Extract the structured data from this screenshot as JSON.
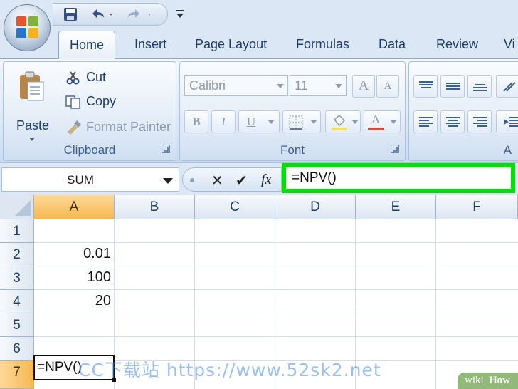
{
  "quick_access": {
    "save_icon": "save-icon",
    "undo_icon": "undo-icon",
    "redo_icon": "redo-icon",
    "customize_icon": "customize-qat-icon"
  },
  "tabs": [
    "Home",
    "Insert",
    "Page Layout",
    "Formulas",
    "Data",
    "Review",
    "Vi"
  ],
  "ribbon": {
    "clipboard": {
      "label": "Clipboard",
      "paste": "Paste",
      "cut": "Cut",
      "copy": "Copy",
      "format_painter": "Format Painter"
    },
    "font": {
      "label": "Font",
      "font_name": "Calibri",
      "font_size": "11",
      "grow_glyph": "A",
      "shrink_glyph": "A",
      "bold_glyph": "B",
      "italic_glyph": "I",
      "underline_glyph": "U",
      "font_color_glyph": "A"
    },
    "alignment": {
      "label": "A"
    }
  },
  "formula_bar": {
    "name_box": "SUM",
    "cancel_glyph": "✕",
    "enter_glyph": "✔",
    "fx_label": "fx",
    "formula": "=NPV()"
  },
  "grid": {
    "columns": [
      "A",
      "B",
      "C",
      "D",
      "E",
      "F"
    ],
    "rows": [
      "1",
      "2",
      "3",
      "4",
      "5",
      "6",
      "7"
    ],
    "selected_column": "A",
    "selected_row": "7",
    "cells": {
      "A2": "0.01",
      "A3": "100",
      "A4": "20",
      "A7": "=NPV()"
    }
  },
  "watermarks": {
    "site": "CC下载站 https://www.52sk2.net",
    "wiki": "wiki",
    "how": "How"
  },
  "colors": {
    "highlight_green": "#00e000",
    "selected_header": "#f5b84f",
    "ribbon_blue": "#dbe7f5"
  }
}
